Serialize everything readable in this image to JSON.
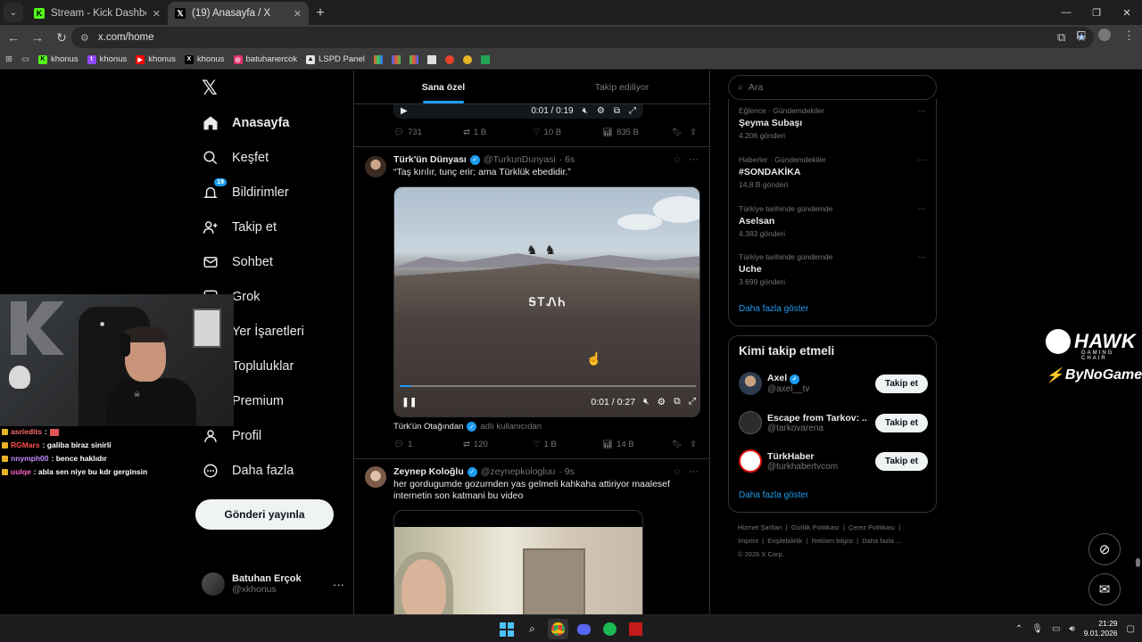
{
  "browser": {
    "tabs": [
      {
        "title": "Stream - Kick Dashboard",
        "icon": "kick-icon",
        "active": false
      },
      {
        "title": "(19) Anasayfa / X",
        "icon": "x-icon",
        "active": true
      }
    ],
    "url": "x.com/home",
    "bookmarks": [
      {
        "label": "khonus",
        "icon": "kick-icon",
        "color": "#53fc18"
      },
      {
        "label": "khonus",
        "icon": "twitch-icon",
        "color": "#9146ff"
      },
      {
        "label": "khonus",
        "icon": "youtube-icon",
        "color": "#ff0000"
      },
      {
        "label": "khonus",
        "icon": "x-icon",
        "color": "#000000"
      },
      {
        "label": "batuhanercok",
        "icon": "instagram-icon",
        "color": "#e1306c"
      },
      {
        "label": "LSPD Panel",
        "icon": "panel-icon",
        "color": "#e3e3e3"
      }
    ]
  },
  "nav": {
    "items": [
      {
        "label": "Anasayfa",
        "icon": "home-icon"
      },
      {
        "label": "Keşfet",
        "icon": "search-icon"
      },
      {
        "label": "Bildirimler",
        "icon": "bell-icon",
        "badge": "19"
      },
      {
        "label": "Takip et",
        "icon": "add-user-icon"
      },
      {
        "label": "Sohbet",
        "icon": "mail-icon"
      },
      {
        "label": "Grok",
        "icon": "grok-icon"
      },
      {
        "label": "Yer İşaretleri",
        "icon": "bookmark-icon"
      },
      {
        "label": "Topluluklar",
        "icon": "communities-icon"
      },
      {
        "label": "Premium",
        "icon": "x-icon"
      },
      {
        "label": "Profil",
        "icon": "user-icon"
      },
      {
        "label": "Daha fazla",
        "icon": "more-circle-icon"
      }
    ],
    "post_button": "Gönderi yayınla",
    "account": {
      "name": "Batuhan Erçok",
      "handle": "@xkhonus"
    }
  },
  "feed": {
    "tabs": [
      "Sana özel",
      "Takip ediliyor"
    ],
    "prev_tweet": {
      "video_time": "0:01 / 0:19",
      "replies": "731",
      "reposts": "1 B",
      "likes": "10 B",
      "views": "835 B"
    },
    "tweet1": {
      "name": "Türk'ün Dünyası",
      "handle": "@TurkunDunyasi",
      "time": "· 6s",
      "text": "“Taş kırılır, tunç erir; ama Türklük ebedidir.”",
      "video_overlay": "ᎦᎢᏁᏂ",
      "video_time": "0:01 / 0:27",
      "video_progress": 0.04,
      "from_name": "Türk'ün Otağından",
      "from_suffix": "adlı kullanıcıdan",
      "replies": "1",
      "reposts": "120",
      "likes": "1 B",
      "views": "14 B"
    },
    "tweet2": {
      "name": "Zeynep Koloğlu",
      "handle": "@zeynepkologluu",
      "time": "· 9s",
      "text": "her gordugumde gozumden yas gelmeli kahkaha attiriyor maalesef internetin son katmani bu video"
    }
  },
  "sidebar": {
    "search_placeholder": "Ara",
    "trends": [
      {
        "context": "Eğlence · Gündemdekiler",
        "title": "Şeyma Subaşı",
        "posts": "4.206 gönderi"
      },
      {
        "context": "Haberler · Gündemdekiler",
        "title": "#SONDAKİKA",
        "posts": "14,8 B gönderi"
      },
      {
        "context": "Türkiye tarihinde gündemde",
        "title": "Aselsan",
        "posts": "4.383 gönderi"
      },
      {
        "context": "Türkiye tarihinde gündemde",
        "title": "Uche",
        "posts": "3.699 gönderi"
      }
    ],
    "show_more": "Daha fazla göster",
    "who_to_follow": {
      "title": "Kimi takip etmeli",
      "users": [
        {
          "name": "Axel",
          "handle": "@axel__tv",
          "verified": true
        },
        {
          "name": "Escape from Tarkov: ...",
          "handle": "@tarkovarena",
          "verified": false
        },
        {
          "name": "TürkHaber",
          "handle": "@turkhabertvcom",
          "verified": false
        }
      ],
      "follow_label": "Takip et",
      "show_more": "Daha fazla göster"
    },
    "footer": {
      "line1": [
        "Hizmet Şartları",
        "Gizlilik Politikası",
        "Çerez Politikası"
      ],
      "line2": [
        "Imprint",
        "Erişilebilirlik",
        "Reklam bilgisi",
        "Daha fazla ..."
      ],
      "copyright": "© 2026 X Corp."
    }
  },
  "overlay": {
    "sponsor": {
      "brand": "HAWK",
      "sub": "GAMING CHAIR",
      "partner": "ByNoGame"
    },
    "chat": [
      {
        "user": "asriedits",
        "color": "#ff6b6b",
        "msg": ":"
      },
      {
        "user": "RGMars",
        "color": "#ff4d4d",
        "msg": ": galiba biraz sinirli"
      },
      {
        "user": "nnymph00",
        "color": "#c58cff",
        "msg": ": bence haklıdır"
      },
      {
        "user": "uulqe",
        "color": "#ff66cc",
        "msg": ": abla sen niye bu kdr gerginsin"
      }
    ]
  },
  "taskbar": {
    "time": "21:29",
    "date": "9.01.2026"
  }
}
